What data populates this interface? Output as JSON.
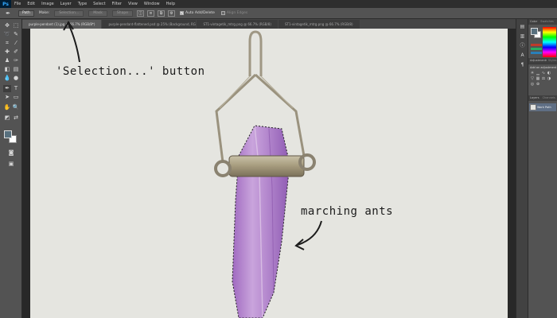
{
  "app": {
    "logo": "Ps"
  },
  "menu": [
    "File",
    "Edit",
    "Image",
    "Layer",
    "Type",
    "Select",
    "Filter",
    "View",
    "Window",
    "Help"
  ],
  "options_bar": {
    "tool_mode": "Path",
    "make_label": "Make:",
    "selection_label": "Selection...",
    "mask_label": "Mask",
    "shape_label": "Shape",
    "auto_add_delete": "Auto Add/Delete",
    "align_edges": "Align Edges"
  },
  "tabs": [
    "purple-pendant (1).jpg @ 66.7% (RGB/8*)",
    "purple-pendant-flattened.psd @ 25% (Background, RGB/8)",
    "ST1-vintagetik_mtrg.png @ 66.7% (RGB/8)",
    "ST1-vintagetik_mtrg.png @ 66.7% (RGB/8)"
  ],
  "annotations": {
    "selection_button": "'Selection...' button",
    "marching_ants": "marching ants"
  },
  "panels": {
    "color_tabs": [
      "Color",
      "Swatches"
    ],
    "adjustments_tabs": [
      "Adjustments",
      "Styles"
    ],
    "adjustments_title": "Add an adjustment",
    "layers_tabs": [
      "Layers",
      "Channels"
    ],
    "layer_name": "Work Path"
  },
  "colors": {
    "foreground": "#58707e",
    "background": "#ffffff",
    "canvas_bg": "#e5e5e0",
    "amethyst": "#b88fcf",
    "silver": "#a39a84"
  }
}
